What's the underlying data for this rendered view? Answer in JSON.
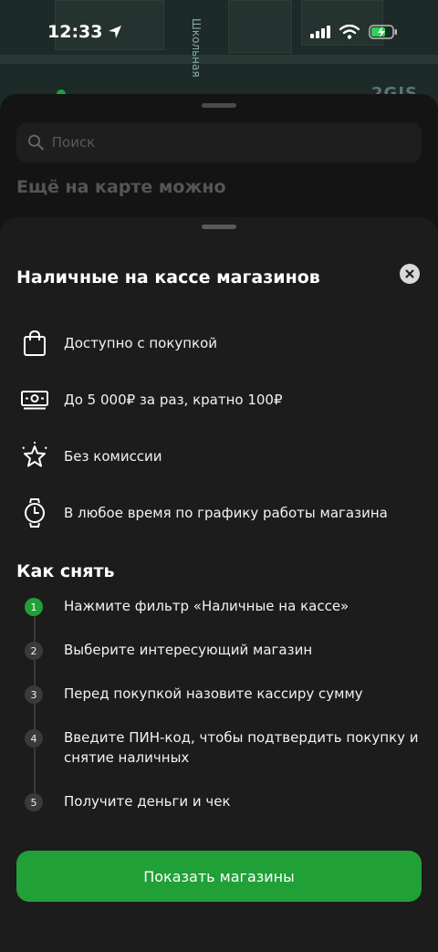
{
  "status_bar": {
    "time": "12:33"
  },
  "map": {
    "street_label": "Школьная",
    "brand_label": "2GIS"
  },
  "back_sheet": {
    "search_placeholder": "Поиск",
    "heading": "Ещё на карте можно"
  },
  "sheet": {
    "title": "Наличные на кассе магазинов",
    "features": [
      {
        "icon": "shopping-bag-icon",
        "text": "Доступно с покупкой"
      },
      {
        "icon": "banknote-icon",
        "text": "До 5 000₽ за раз, кратно 100₽"
      },
      {
        "icon": "star-icon",
        "text": "Без комиссии"
      },
      {
        "icon": "watch-icon",
        "text": "В любое время по графику работы магазина"
      }
    ],
    "how_title": "Как снять",
    "steps": [
      {
        "num": "1",
        "text": "Нажмите фильтр «Наличные на кассе»"
      },
      {
        "num": "2",
        "text": "Выберите интересующий магазин"
      },
      {
        "num": "3",
        "text": "Перед покупкой назовите кассиру сумму"
      },
      {
        "num": "4",
        "text": "Введите ПИН-код, чтобы подтвердить покупку и снятие наличных"
      },
      {
        "num": "5",
        "text": "Получите деньги и чек"
      }
    ],
    "cta_label": "Показать магазины"
  },
  "colors": {
    "accent": "#21a038",
    "sheet_bg": "#1c1c1c"
  }
}
